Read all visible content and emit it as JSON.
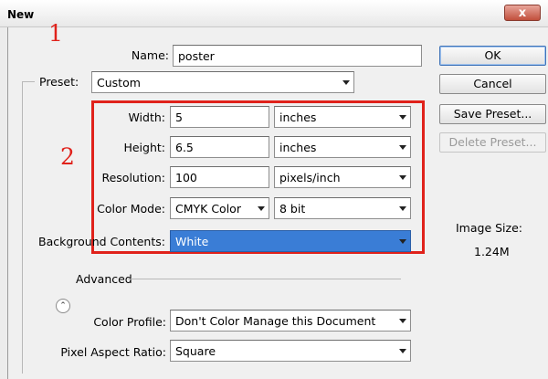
{
  "window": {
    "title": "New",
    "close_glyph": "x"
  },
  "annotations": {
    "step1": "1",
    "step2": "2"
  },
  "form": {
    "name_label": "Name:",
    "name_value": "poster",
    "preset_label": "Preset:",
    "preset_value": "Custom",
    "width_label": "Width:",
    "width_value": "5",
    "width_unit": "inches",
    "height_label": "Height:",
    "height_value": "6.5",
    "height_unit": "inches",
    "resolution_label": "Resolution:",
    "resolution_value": "100",
    "resolution_unit": "pixels/inch",
    "color_mode_label": "Color Mode:",
    "color_mode_value": "CMYK Color",
    "bit_depth_value": "8 bit",
    "background_label": "Background Contents:",
    "background_value": "White",
    "advanced_label": "Advanced",
    "color_profile_label": "Color Profile:",
    "color_profile_value": "Don't Color Manage this Document",
    "pixel_aspect_label": "Pixel Aspect Ratio:",
    "pixel_aspect_value": "Square"
  },
  "buttons": {
    "ok": "OK",
    "cancel": "Cancel",
    "save_preset": "Save Preset...",
    "delete_preset": "Delete Preset..."
  },
  "image_size": {
    "label": "Image Size:",
    "value": "1.24M"
  },
  "colors": {
    "annotation_red": "#e0221b",
    "highlight_blue": "#3a7dd6"
  },
  "icons": [
    "close-icon",
    "dropdown-arrow-icon",
    "chevron-up-icon"
  ]
}
